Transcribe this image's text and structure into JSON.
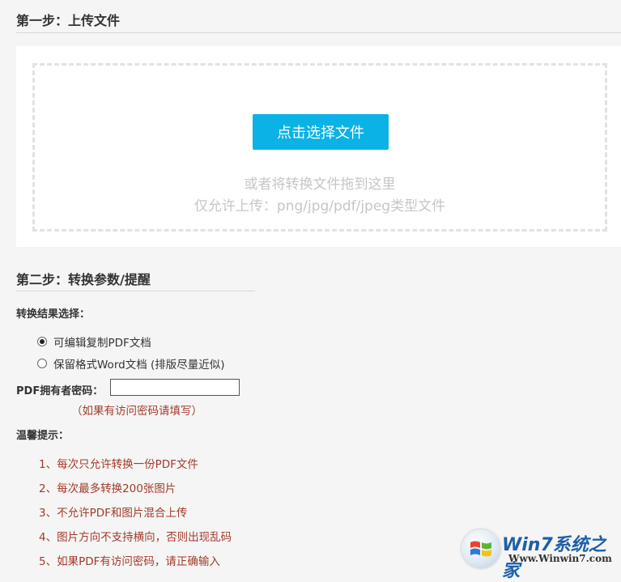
{
  "step1": {
    "title": "第一步：上传文件",
    "choose_button": "点击选择文件",
    "drag_hint": "或者将转换文件拖到这里",
    "allowed_types": "仅允许上传：png/jpg/pdf/jpeg类型文件"
  },
  "step2": {
    "title": "第二步：转换参数/提醒",
    "result_label": "转换结果选择：",
    "options": [
      {
        "label": "可编辑复制PDF文档",
        "checked": true
      },
      {
        "label": "保留格式Word文档 (排版尽量近似)",
        "checked": false
      }
    ],
    "password_label": "PDF拥有者密码：",
    "password_value": "",
    "password_note": "（如果有访问密码请填写）",
    "tips_label": "温馨提示：",
    "tips": [
      "1、每次只允许转换一份PDF文件",
      "2、每次最多转换200张图片",
      "3、不允许PDF和图片混合上传",
      "4、图片方向不支持横向，否则出现乱码",
      "5、如果PDF有访问密码，请正确输入"
    ]
  },
  "watermark": {
    "title": "Win7系统之家",
    "url": "Www.Winwin7.com"
  },
  "colors": {
    "accent": "#0bb2e6",
    "tip_red": "#a33a2a"
  }
}
